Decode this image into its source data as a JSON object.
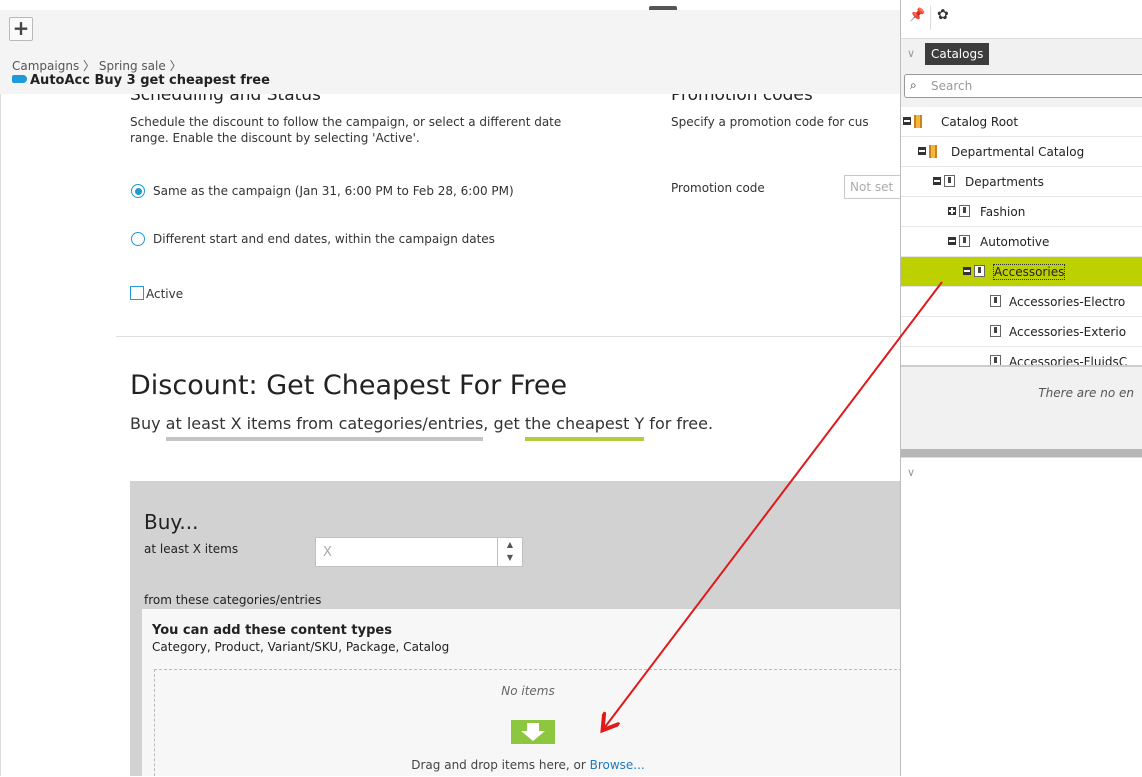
{
  "header": {
    "add_label": "+",
    "breadcrumb": [
      "Campaigns",
      "Spring sale"
    ],
    "title": "AutoAcc Buy 3 get cheapest free"
  },
  "scheduling": {
    "heading": "Scheduling and Status",
    "desc1": "Schedule the discount to follow the campaign, or select a different date",
    "desc2": "range. Enable the discount by selecting 'Active'.",
    "option_same": "Same as the campaign (Jan 31, 6:00 PM to Feb 28, 6:00 PM)",
    "option_diff": "Different start and end dates, within the campaign dates",
    "active_label": "Active"
  },
  "promo": {
    "heading": "Promotion codes",
    "desc": "Specify a promotion code for cus",
    "code_label": "Promotion code",
    "code_placeholder": "Not set"
  },
  "discount": {
    "heading": "Discount: Get Cheapest For Free",
    "lead_a": "Buy ",
    "lead_b": "at least X items from categories/entries",
    "lead_c": ", get ",
    "lead_d": "the cheapest Y",
    "lead_e": " for free."
  },
  "buy": {
    "heading": "Buy...",
    "at_least_label": "at least X items",
    "x_placeholder": "X",
    "from_label": "from these categories/entries",
    "types_title": "You can add these content types",
    "types_list": "Category, Product, Variant/SKU, Package, Catalog",
    "no_items": "No items",
    "drag_text": "Drag and drop items here, or ",
    "browse": "Browse..."
  },
  "right_panel": {
    "tab": "Catalogs",
    "search_placeholder": "Search",
    "tree": [
      {
        "label": "Catalog Root"
      },
      {
        "label": "Departmental Catalog"
      },
      {
        "label": "Departments"
      },
      {
        "label": "Fashion"
      },
      {
        "label": "Automotive"
      },
      {
        "label": "Accessories"
      },
      {
        "label": "Accessories-Electro"
      },
      {
        "label": "Accessories-Exterio"
      },
      {
        "label": "Accessories-FluidsC"
      }
    ],
    "no_entries": "There are no en"
  },
  "colors": {
    "accent": "#1e9ad6",
    "selected_tree": "#bdd100",
    "drop_icon": "#8dc63f",
    "drag_arrow": "#e0191b"
  }
}
